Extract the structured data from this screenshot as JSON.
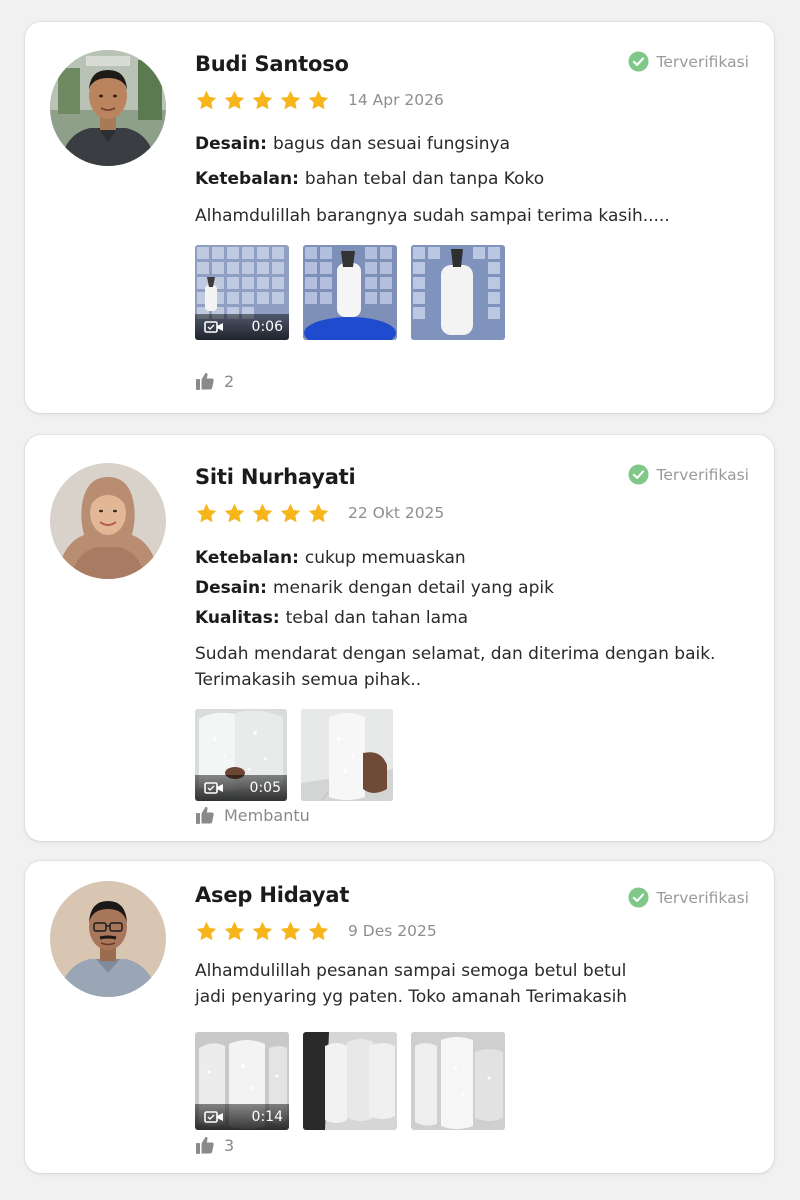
{
  "colors": {
    "star": "#f7b51c",
    "verified": "#7fc88a",
    "muted_text": "#8e8e8e"
  },
  "reviews": [
    {
      "name": "Budi Santoso",
      "rating": 5,
      "date": "14 Apr 2026",
      "verified_label": "Terverifikasi",
      "attributes": [
        {
          "label": "Desain:",
          "value": "bagus dan sesuai fungsinya"
        },
        {
          "label": "Ketebalan:",
          "value": "bahan tebal dan tanpa Koko"
        }
      ],
      "text": "Alhamdulillah barangnya sudah sampai terima kasih.....",
      "media": [
        {
          "type": "video",
          "duration": "0:06"
        },
        {
          "type": "image"
        },
        {
          "type": "image"
        }
      ],
      "helpful": "2"
    },
    {
      "name": "Siti Nurhayati",
      "rating": 5,
      "date": "22 Okt 2025",
      "verified_label": "Terverifikasi",
      "attributes": [
        {
          "label": "Ketebalan:",
          "value": "cukup memuaskan"
        },
        {
          "label": "Desain:",
          "value": "menarik dengan detail yang apik"
        },
        {
          "label": "Kualitas:",
          "value": "tebal dan tahan lama"
        }
      ],
      "text_lines": [
        "Sudah mendarat dengan selamat, dan diterima dengan baik.",
        "Terimakasih semua pihak.."
      ],
      "media": [
        {
          "type": "video",
          "duration": "0:05"
        },
        {
          "type": "image"
        }
      ],
      "helpful": "Membantu"
    },
    {
      "name": "Asep Hidayat",
      "rating": 5,
      "date": "9 Des 2025",
      "verified_label": "Terverifikasi",
      "text_lines": [
        "Alhamdulillah pesanan sampai semoga betul betul",
        "jadi penyaring yg paten. Toko amanah Terimakasih"
      ],
      "media": [
        {
          "type": "video",
          "duration": "0:14"
        },
        {
          "type": "image"
        },
        {
          "type": "image"
        }
      ],
      "helpful": "3"
    }
  ]
}
